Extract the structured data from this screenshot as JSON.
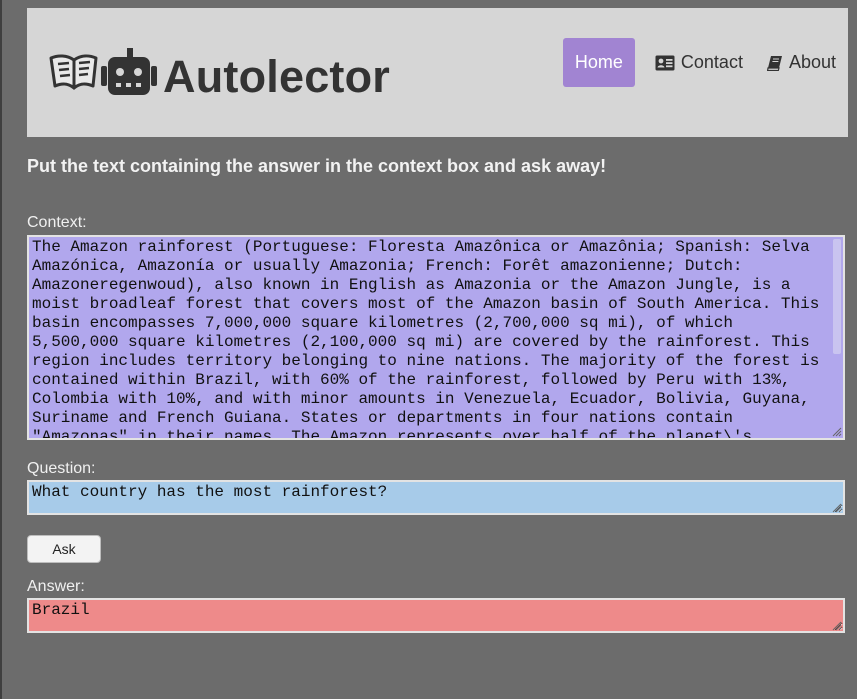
{
  "header": {
    "brand": "Autolector",
    "logo_icons": [
      "open-book-icon",
      "robot-icon"
    ],
    "nav": [
      {
        "label": "Home",
        "icon": null,
        "active": true
      },
      {
        "label": "Contact",
        "icon": "address-card-icon",
        "active": false
      },
      {
        "label": "About",
        "icon": "book-icon",
        "active": false
      }
    ]
  },
  "main": {
    "instruction": "Put the text containing the answer in the context box and ask away!",
    "context": {
      "label": "Context:",
      "value": "The Amazon rainforest (Portuguese: Floresta Amazônica or Amazônia; Spanish: Selva Amazónica, Amazonía or usually Amazonia; French: Forêt amazonienne; Dutch: Amazoneregenwoud), also known in English as Amazonia or the Amazon Jungle, is a moist broadleaf forest that covers most of the Amazon basin of South America. This basin encompasses 7,000,000 square kilometres (2,700,000 sq mi), of which 5,500,000 square kilometres (2,100,000 sq mi) are covered by the rainforest. This region includes territory belonging to nine nations. The majority of the forest is contained within Brazil, with 60% of the rainforest, followed by Peru with 13%, Colombia with 10%, and with minor amounts in Venezuela, Ecuador, Bolivia, Guyana, Suriname and French Guiana. States or departments in four nations contain \"Amazonas\" in their names. The Amazon represents over half of the planet\\'s",
      "color": "#b1a7ed"
    },
    "question": {
      "label": "Question:",
      "value": "What country has the most rainforest?",
      "color": "#a7cbe9"
    },
    "ask_button": {
      "label": "Ask"
    },
    "answer": {
      "label": "Answer:",
      "value": "Brazil",
      "color": "#ee8a8a"
    }
  },
  "colors": {
    "page_background": "#6c6c6c",
    "header_background": "#d6d6d6",
    "nav_active": "#a184d2"
  }
}
